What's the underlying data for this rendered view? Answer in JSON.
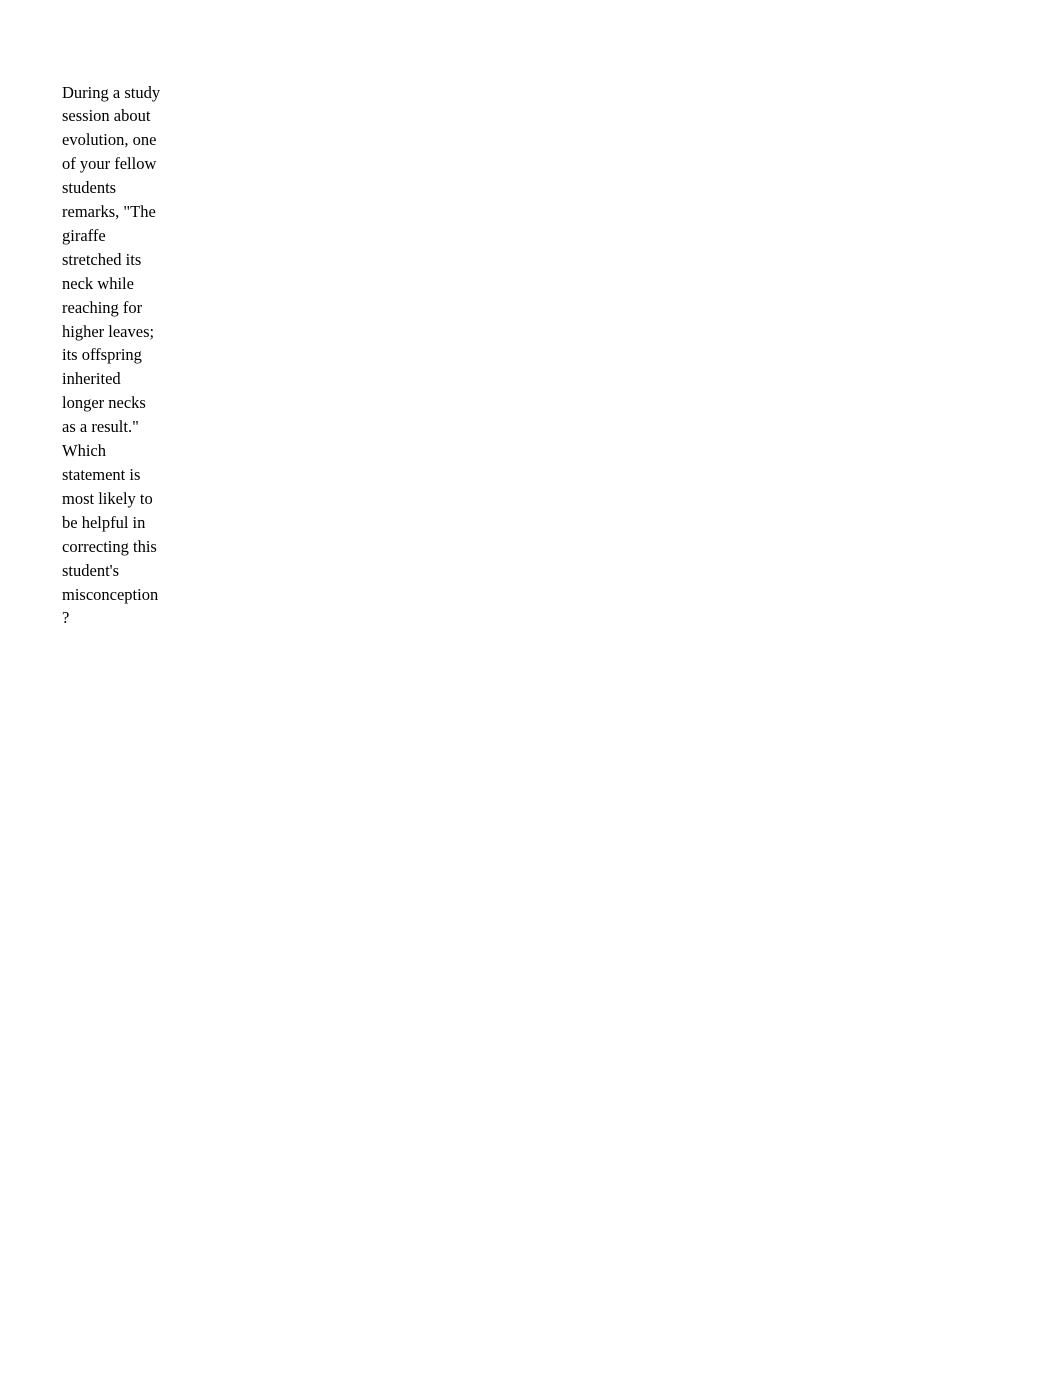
{
  "document": {
    "background_color": "#ffffff",
    "text_color": "#000000",
    "question": {
      "prompt": "During a study session about evolution, one of your fellow students remarks, \"The giraffe stretched its neck while reaching for higher leaves; its offspring inherited longer necks as a result.\" Which statement is most likely to be helpful in correcting this student's misconception?"
    }
  }
}
